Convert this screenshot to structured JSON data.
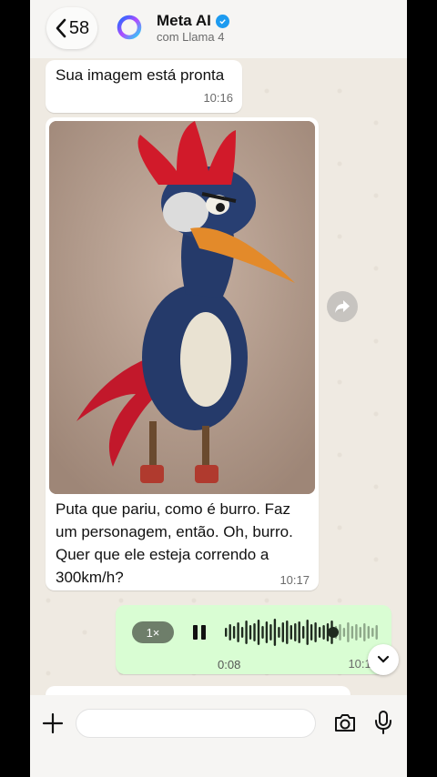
{
  "header": {
    "back_count": "58",
    "contact_name": "Meta AI",
    "subtitle": "com Llama 4"
  },
  "messages": [
    {
      "text": "Sua imagem está pronta",
      "time": "10:16"
    },
    {
      "image": "cartoon-woodpecker-bird",
      "text": "Puta que pariu, como é burro. Faz um personagem, então. Oh, burro. Quer que ele esteja correndo a 300km/h?",
      "time": "10:17"
    }
  ],
  "voice_note": {
    "speed": "1×",
    "duration": "0:08",
    "time": "10:17",
    "played_fraction": 0.7
  },
  "input": {
    "placeholder": ""
  },
  "colors": {
    "outgoing": "#d9fdd3",
    "incoming": "#ffffff",
    "verified": "#1d9bf0"
  }
}
